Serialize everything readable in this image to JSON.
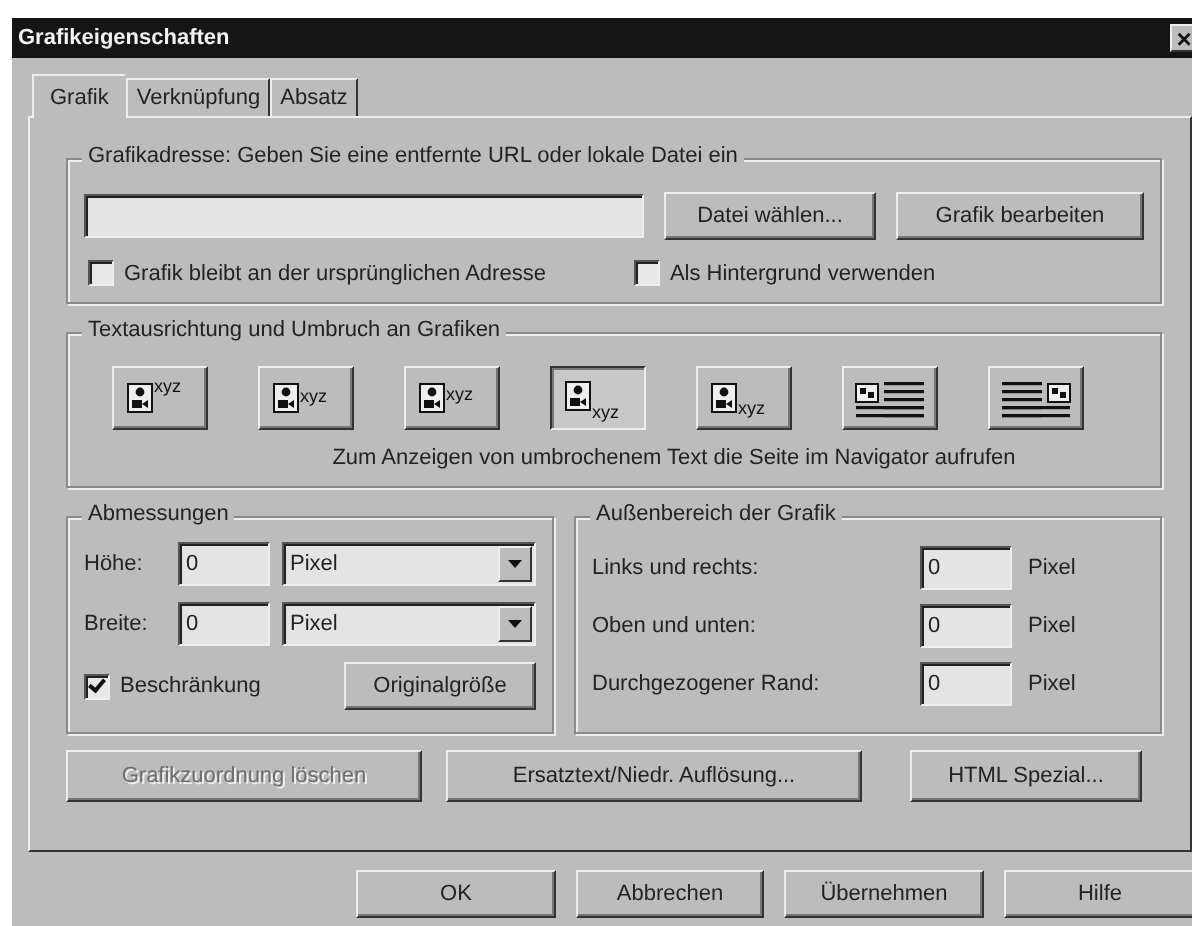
{
  "window": {
    "title": "Grafikeigenschaften",
    "close": "×"
  },
  "tabs": [
    {
      "label": "Grafik",
      "selected": true
    },
    {
      "label": "Verknüpfung",
      "selected": false
    },
    {
      "label": "Absatz",
      "selected": false
    }
  ],
  "address_group": {
    "legend": "Grafikadresse: Geben Sie eine entfernte URL oder lokale Datei ein",
    "buttons": [
      {
        "label": "Datei wählen...",
        "disabled": false
      },
      {
        "label": "Grafik bearbeiten",
        "disabled": false
      }
    ],
    "checkboxes": [
      {
        "label": "Grafik bleibt an der ursprünglichen Adresse",
        "checked": false
      },
      {
        "label": "Als Hintergrund verwenden",
        "checked": false
      }
    ]
  },
  "alignment_group": {
    "legend": "Textausrichtung und Umbruch an Grafiken",
    "options": [
      {
        "kind": "top",
        "label": "xyz",
        "selected": false
      },
      {
        "kind": "middle",
        "label": "xyz",
        "selected": false
      },
      {
        "kind": "center",
        "label": "xyz",
        "selected": false
      },
      {
        "kind": "bottom",
        "label": "xyz",
        "selected": true
      },
      {
        "kind": "baseline",
        "label": "xyz",
        "selected": false
      },
      {
        "kind": "wrap-right",
        "selected": false
      },
      {
        "kind": "wrap-left",
        "selected": false
      }
    ],
    "note": "Zum Anzeigen von umbrochenem Text die Seite im Navigator aufrufen"
  },
  "dimensions_group": {
    "legend": "Abmessungen",
    "rows": [
      {
        "label": "Höhe:",
        "value": "0",
        "unit": "Pixel"
      },
      {
        "label": "Breite:",
        "value": "0",
        "unit": "Pixel"
      }
    ],
    "constrain": {
      "label": "Beschränkung",
      "checked": true
    },
    "button": {
      "label": "Originalgröße",
      "disabled": false
    }
  },
  "spacing_group": {
    "legend": "Außenbereich der Grafik",
    "rows": [
      {
        "label": "Links und rechts:",
        "value": "0",
        "unit": "Pixel"
      },
      {
        "label": "Oben und unten:",
        "value": "0",
        "unit": "Pixel"
      },
      {
        "label": "Durchgezogener Rand:",
        "value": "0",
        "unit": "Pixel"
      }
    ]
  },
  "panel_buttons": [
    {
      "label": "Grafikzuordnung löschen",
      "disabled": true
    },
    {
      "label": "Ersatztext/Niedr. Auflösung...",
      "disabled": false
    },
    {
      "label": "HTML Spezial...",
      "disabled": false
    }
  ],
  "dialog_buttons": [
    {
      "label": "OK",
      "disabled": false
    },
    {
      "label": "Abbrechen",
      "disabled": false
    },
    {
      "label": "Übernehmen",
      "disabled": false
    },
    {
      "label": "Hilfe",
      "disabled": false
    }
  ]
}
